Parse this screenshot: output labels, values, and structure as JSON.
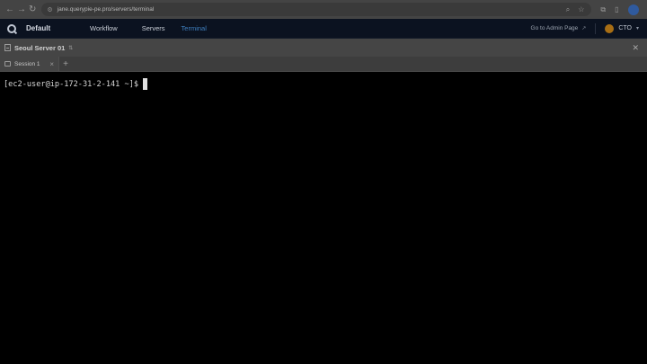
{
  "browser": {
    "url": "jane.querypie-pe.pro/servers/terminal",
    "profile_initial": "●"
  },
  "header": {
    "workspace": "Default",
    "tabs": [
      {
        "label": "Workflow",
        "active": false
      },
      {
        "label": "Servers",
        "active": false
      },
      {
        "label": "Terminal",
        "active": true
      }
    ],
    "admin_link": "Go to Admin Page",
    "user": "CTO"
  },
  "server_bar": {
    "server_name": "Seoul Server 01"
  },
  "sessions": {
    "tabs": [
      {
        "label": "Session 1"
      }
    ]
  },
  "terminal": {
    "prompt": "[ec2-user@ip-172-31-2-141 ~]$"
  },
  "colors": {
    "accent": "#3f7fbf",
    "header_bg": "#0b1220",
    "terminal_bg": "#000000",
    "avatar": "#a86e14"
  }
}
